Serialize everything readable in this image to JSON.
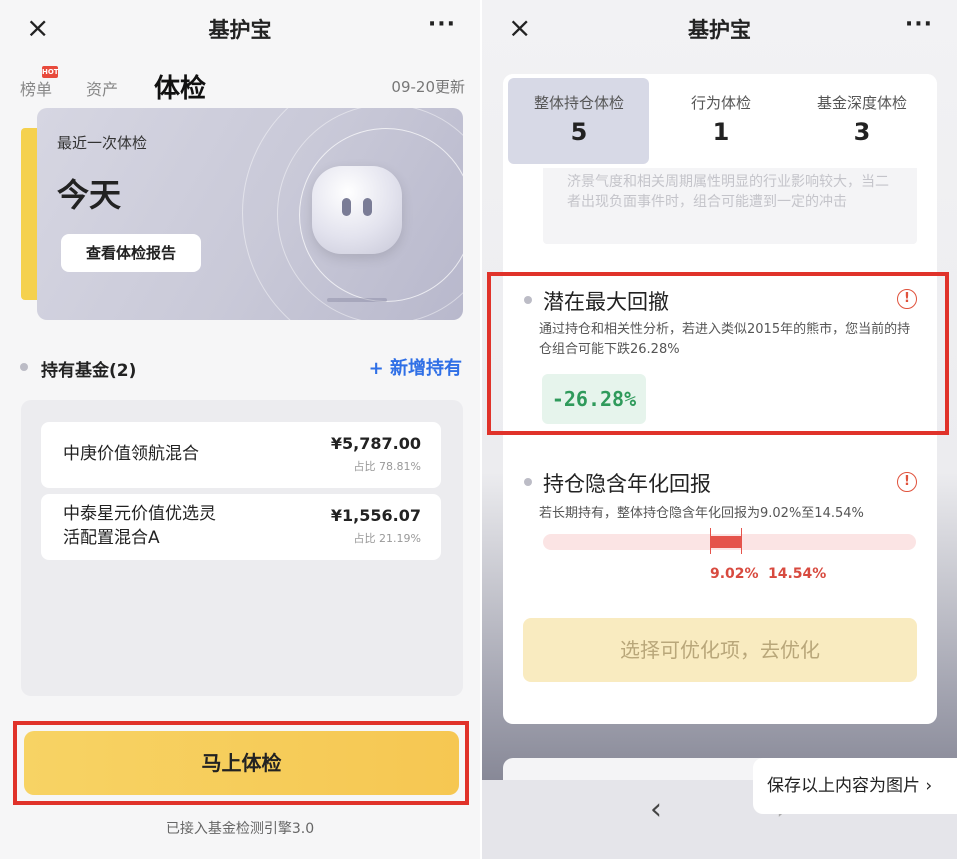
{
  "left": {
    "nav": {
      "close": "×",
      "title": "基护宝",
      "more": "···"
    },
    "tabs": {
      "rank": "榜单",
      "hot_badge": "HOT",
      "assets": "资产",
      "checkup": "体检",
      "updated": "09-20更新"
    },
    "card": {
      "subtitle": "最近一次体检",
      "date": "今天",
      "button": "查看体检报告"
    },
    "holdings": {
      "title": "持有基金(2)",
      "add_label": "+ 新增持有",
      "items": [
        {
          "name": "中庚价值领航混合",
          "amount": "¥5,787.00",
          "ratio": "占比 78.81%"
        },
        {
          "name": "中泰星元价值优选灵活配置混合A",
          "name_line1": "中泰星元价值优选灵",
          "name_line2": "活配置混合A",
          "amount": "¥1,556.07",
          "ratio": "占比 21.19%"
        }
      ]
    },
    "main_button": "马上体检",
    "engine_text": "已接入基金检测引擎3.0"
  },
  "right": {
    "nav": {
      "close": "×",
      "title": "基护宝",
      "more": "···"
    },
    "tabs": [
      {
        "label": "整体持仓体检",
        "count": "5"
      },
      {
        "label": "行为体检",
        "count": "1"
      },
      {
        "label": "基金深度体检",
        "count": "3"
      }
    ],
    "ghost_text": "济景气度和相关周期属性明显的行业影响较大，当二者出现负面事件时，组合可能遭到一定的冲击",
    "drawdown": {
      "title": "潜在最大回撤",
      "warn": "!",
      "desc": "通过持仓和相关性分析，若进入类似2015年的熊市，您当前的持仓组合可能下跌26.28%",
      "value": "-26.28%"
    },
    "annual_return": {
      "title": "持仓隐含年化回报",
      "warn": "!",
      "desc": "若长期持有，整体持仓隐含年化回报为9.02%至14.54%",
      "low_label": "9.02%",
      "high_label": "14.54%",
      "range": [
        9.02,
        14.54
      ]
    },
    "optimize_button": "选择可优化项，去优化",
    "save_label": "保存以上内容为图片 ›",
    "back": "‹",
    "forward": "›"
  },
  "colors": {
    "accent_blue": "#2f6fe6",
    "highlight_red": "#e0322a",
    "drawdown_green": "#2f9a5b",
    "return_red": "#d84a3f",
    "button_yellow": "#f6c752"
  }
}
